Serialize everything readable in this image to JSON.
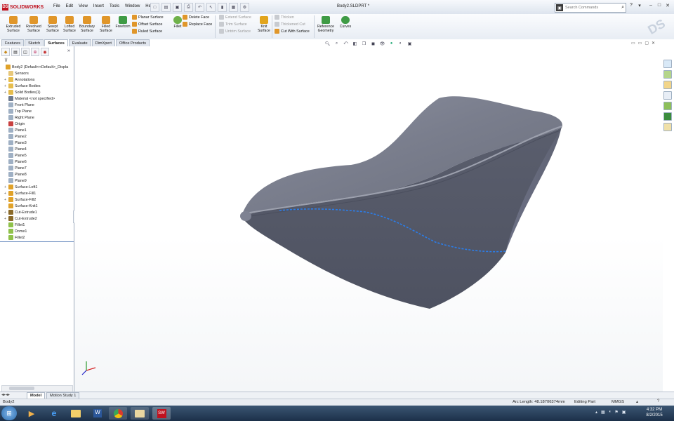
{
  "app": {
    "brand": "SOLIDWORKS",
    "document_title": "Body2.SLDPRT *"
  },
  "menu": [
    "File",
    "Edit",
    "View",
    "Insert",
    "Tools",
    "Window",
    "Help"
  ],
  "search": {
    "placeholder": "Search Commands"
  },
  "command_manager": {
    "big_buttons": [
      {
        "label": "Extruded Surface",
        "icon": "extruded-surface-icon"
      },
      {
        "label": "Revolved Surface",
        "icon": "revolved-surface-icon"
      },
      {
        "label": "Swept Surface",
        "icon": "swept-surface-icon"
      },
      {
        "label": "Lofted Surface",
        "icon": "lofted-surface-icon"
      },
      {
        "label": "Boundary Surface",
        "icon": "boundary-surface-icon"
      },
      {
        "label": "Filled Surface",
        "icon": "filled-surface-icon"
      },
      {
        "label": "Freeform",
        "icon": "freeform-icon"
      }
    ],
    "col1": [
      "Planar Surface",
      "Offset Surface",
      "Ruled Surface"
    ],
    "fillet": "Fillet",
    "col2": [
      "Delete Face",
      "Replace Face"
    ],
    "col3": [
      "Extend Surface",
      "Trim Surface",
      "Untrim Surface"
    ],
    "knit": "Knit Surface",
    "col4": [
      "Thicken",
      "Thickened Cut",
      "Cut With Surface"
    ],
    "reference_geometry": "Reference Geometry",
    "curves": "Curves"
  },
  "tabs": [
    "Features",
    "Sketch",
    "Surfaces",
    "Evaluate",
    "DimXpert",
    "Office Products"
  ],
  "active_tab": "Surfaces",
  "tree": [
    {
      "label": "Body2  (Default<<Default>_Displa",
      "icon": "part-icon",
      "expander": ""
    },
    {
      "label": "Sensors",
      "icon": "sensor-icon",
      "expander": ""
    },
    {
      "label": "Annotations",
      "icon": "annotation-icon",
      "expander": "+"
    },
    {
      "label": "Surface Bodies",
      "icon": "folder-icon",
      "expander": "+"
    },
    {
      "label": "Solid Bodies(1)",
      "icon": "folder-icon",
      "expander": "+"
    },
    {
      "label": "Material <not specified>",
      "icon": "material-icon",
      "expander": ""
    },
    {
      "label": "Front Plane",
      "icon": "plane-icon",
      "expander": ""
    },
    {
      "label": "Top Plane",
      "icon": "plane-icon",
      "expander": ""
    },
    {
      "label": "Right Plane",
      "icon": "plane-icon",
      "expander": ""
    },
    {
      "label": "Origin",
      "icon": "origin-icon",
      "expander": ""
    },
    {
      "label": "Plane1",
      "icon": "plane-icon",
      "expander": ""
    },
    {
      "label": "Plane2",
      "icon": "plane-icon",
      "expander": ""
    },
    {
      "label": "Plane3",
      "icon": "plane-icon",
      "expander": ""
    },
    {
      "label": "Plane4",
      "icon": "plane-icon",
      "expander": ""
    },
    {
      "label": "Plane5",
      "icon": "plane-icon",
      "expander": ""
    },
    {
      "label": "Plane6",
      "icon": "plane-icon",
      "expander": ""
    },
    {
      "label": "Plane7",
      "icon": "plane-icon",
      "expander": ""
    },
    {
      "label": "Plane8",
      "icon": "plane-icon",
      "expander": ""
    },
    {
      "label": "Plane9",
      "icon": "plane-icon",
      "expander": ""
    },
    {
      "label": "Surface-Loft1",
      "icon": "surface-feature-icon",
      "expander": "+"
    },
    {
      "label": "Surface-Fill1",
      "icon": "surface-feature-icon",
      "expander": "+"
    },
    {
      "label": "Surface-Fill2",
      "icon": "surface-feature-icon",
      "expander": "+"
    },
    {
      "label": "Surface-Knit1",
      "icon": "surface-feature-icon",
      "expander": ""
    },
    {
      "label": "Cut-Extrude1",
      "icon": "cut-icon",
      "expander": "+"
    },
    {
      "label": "Cut-Extrude2",
      "icon": "cut-icon",
      "expander": "+"
    },
    {
      "label": "Fillet1",
      "icon": "fillet-icon",
      "expander": ""
    },
    {
      "label": "Dome1",
      "icon": "dome-icon",
      "expander": ""
    },
    {
      "label": "Fillet2",
      "icon": "fillet-icon",
      "expander": ""
    }
  ],
  "bottom_tabs": [
    "Model",
    "Motion Study 1"
  ],
  "status": {
    "left": "Body2",
    "arc_length": "Arc Length: 48.18706374mm",
    "mode": "Editing Part",
    "units": "MMGS"
  },
  "clock": {
    "time": "4:32 PM",
    "date": "8/2/2015"
  },
  "colors": {
    "accent": "#c0121f",
    "model": "#5d6170",
    "selection": "#2b7de9"
  }
}
